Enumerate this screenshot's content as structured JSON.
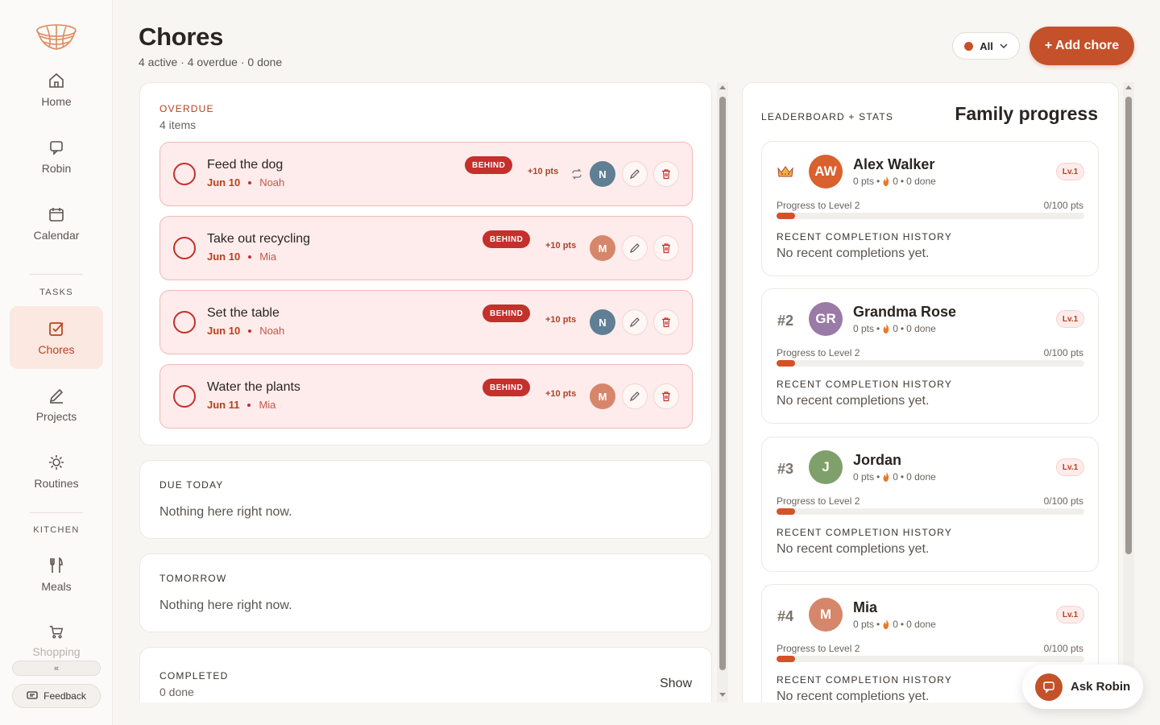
{
  "sidebar": {
    "nav": [
      {
        "label": "Home",
        "icon": "home-icon"
      },
      {
        "label": "Robin",
        "icon": "chat-icon"
      },
      {
        "label": "Calendar",
        "icon": "calendar-icon"
      }
    ],
    "tasks_section": "TASKS",
    "tasks": [
      {
        "label": "Chores",
        "icon": "checkbox-icon",
        "active": true
      },
      {
        "label": "Projects",
        "icon": "pencil-icon"
      },
      {
        "label": "Routines",
        "icon": "sun-icon"
      }
    ],
    "kitchen_section": "KITCHEN",
    "kitchen": [
      {
        "label": "Meals",
        "icon": "fork-knife-icon"
      },
      {
        "label": "Shopping",
        "icon": "cart-icon"
      }
    ],
    "collapse_label": "«",
    "feedback_label": "Feedback"
  },
  "header": {
    "title": "Chores",
    "subtitle": "4 active · 4 overdue · 0 done",
    "filter_label": "All",
    "add_label": "+ Add chore"
  },
  "overdue": {
    "label": "OVERDUE",
    "count": "4 items",
    "items": [
      {
        "title": "Feed the dog",
        "date": "Jun 10",
        "assignee": "Noah",
        "badge": "BEHIND",
        "points": "+10 pts",
        "avatar": "N",
        "avatar_color": "#5f7f94",
        "repeat": true
      },
      {
        "title": "Take out recycling",
        "date": "Jun 10",
        "assignee": "Mia",
        "badge": "BEHIND",
        "points": "+10 pts",
        "avatar": "M",
        "avatar_color": "#d6866a",
        "repeat": false
      },
      {
        "title": "Set the table",
        "date": "Jun 10",
        "assignee": "Noah",
        "badge": "BEHIND",
        "points": "+10 pts",
        "avatar": "N",
        "avatar_color": "#5f7f94",
        "repeat": false
      },
      {
        "title": "Water the plants",
        "date": "Jun 11",
        "assignee": "Mia",
        "badge": "BEHIND",
        "points": "+10 pts",
        "avatar": "M",
        "avatar_color": "#d6866a",
        "repeat": false
      }
    ]
  },
  "due_today": {
    "label": "DUE TODAY",
    "empty": "Nothing here right now."
  },
  "tomorrow": {
    "label": "TOMORROW",
    "empty": "Nothing here right now."
  },
  "completed": {
    "label": "COMPLETED",
    "count": "0 done",
    "toggle": "Show"
  },
  "leaderboard": {
    "label": "LEADERBOARD + STATS",
    "title": "Family progress",
    "progress_label": "Progress to Level 2",
    "history_label": "RECENT COMPLETION HISTORY",
    "history_empty": "No recent completions yet.",
    "members": [
      {
        "rank": "crown",
        "initials": "AW",
        "name": "Alex Walker",
        "pts": "0 pts",
        "streak": "0",
        "done": "0 done",
        "level": "Lv.1",
        "progress": "0/100 pts",
        "progress_fraction": 0,
        "avatar_color": "#d9612e"
      },
      {
        "rank": "#2",
        "initials": "GR",
        "name": "Grandma Rose",
        "pts": "0 pts",
        "streak": "0",
        "done": "0 done",
        "level": "Lv.1",
        "progress": "0/100 pts",
        "progress_fraction": 0,
        "avatar_color": "#9a7aa6"
      },
      {
        "rank": "#3",
        "initials": "J",
        "name": "Jordan",
        "pts": "0 pts",
        "streak": "0",
        "done": "0 done",
        "level": "Lv.1",
        "progress": "0/100 pts",
        "progress_fraction": 0,
        "avatar_color": "#7fa06b"
      },
      {
        "rank": "#4",
        "initials": "M",
        "name": "Mia",
        "pts": "0 pts",
        "streak": "0",
        "done": "0 done",
        "level": "Lv.1",
        "progress": "0/100 pts",
        "progress_fraction": 0,
        "avatar_color": "#d6866a"
      }
    ]
  },
  "ask_robin": {
    "label": "Ask Robin"
  },
  "colors": {
    "accent": "#c4512a",
    "danger": "#c4302b",
    "overdue_bg": "#fdeceb"
  }
}
